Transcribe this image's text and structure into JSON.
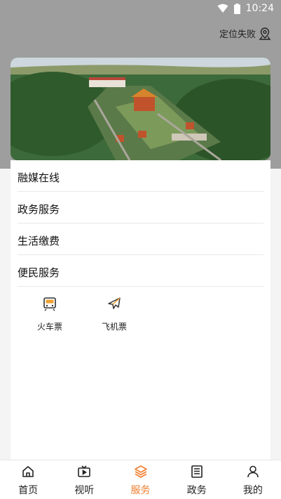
{
  "status_bar": {
    "time": "10:24",
    "wifi_icon": "wifi-icon",
    "battery_icon": "battery-icon"
  },
  "header": {
    "location_text": "定位失败",
    "location_icon": "location-pin-icon"
  },
  "banner": {
    "image": "temple-aerial-photo"
  },
  "sections": [
    {
      "label": "融媒在线"
    },
    {
      "label": "政务服务"
    },
    {
      "label": "生活缴费"
    },
    {
      "label": "便民服务"
    }
  ],
  "services": [
    {
      "label": "火车票",
      "icon": "train-icon"
    },
    {
      "label": "飞机票",
      "icon": "airplane-icon"
    }
  ],
  "tabs": [
    {
      "label": "首页",
      "icon": "home-icon",
      "active": false
    },
    {
      "label": "视听",
      "icon": "tv-play-icon",
      "active": false
    },
    {
      "label": "服务",
      "icon": "layers-icon",
      "active": true
    },
    {
      "label": "政务",
      "icon": "newspaper-icon",
      "active": false
    },
    {
      "label": "我的",
      "icon": "user-icon",
      "active": false
    }
  ],
  "colors": {
    "accent": "#f07f2f",
    "header_bg": "#9e9e9e",
    "page_bg": "#f4f4f4"
  }
}
